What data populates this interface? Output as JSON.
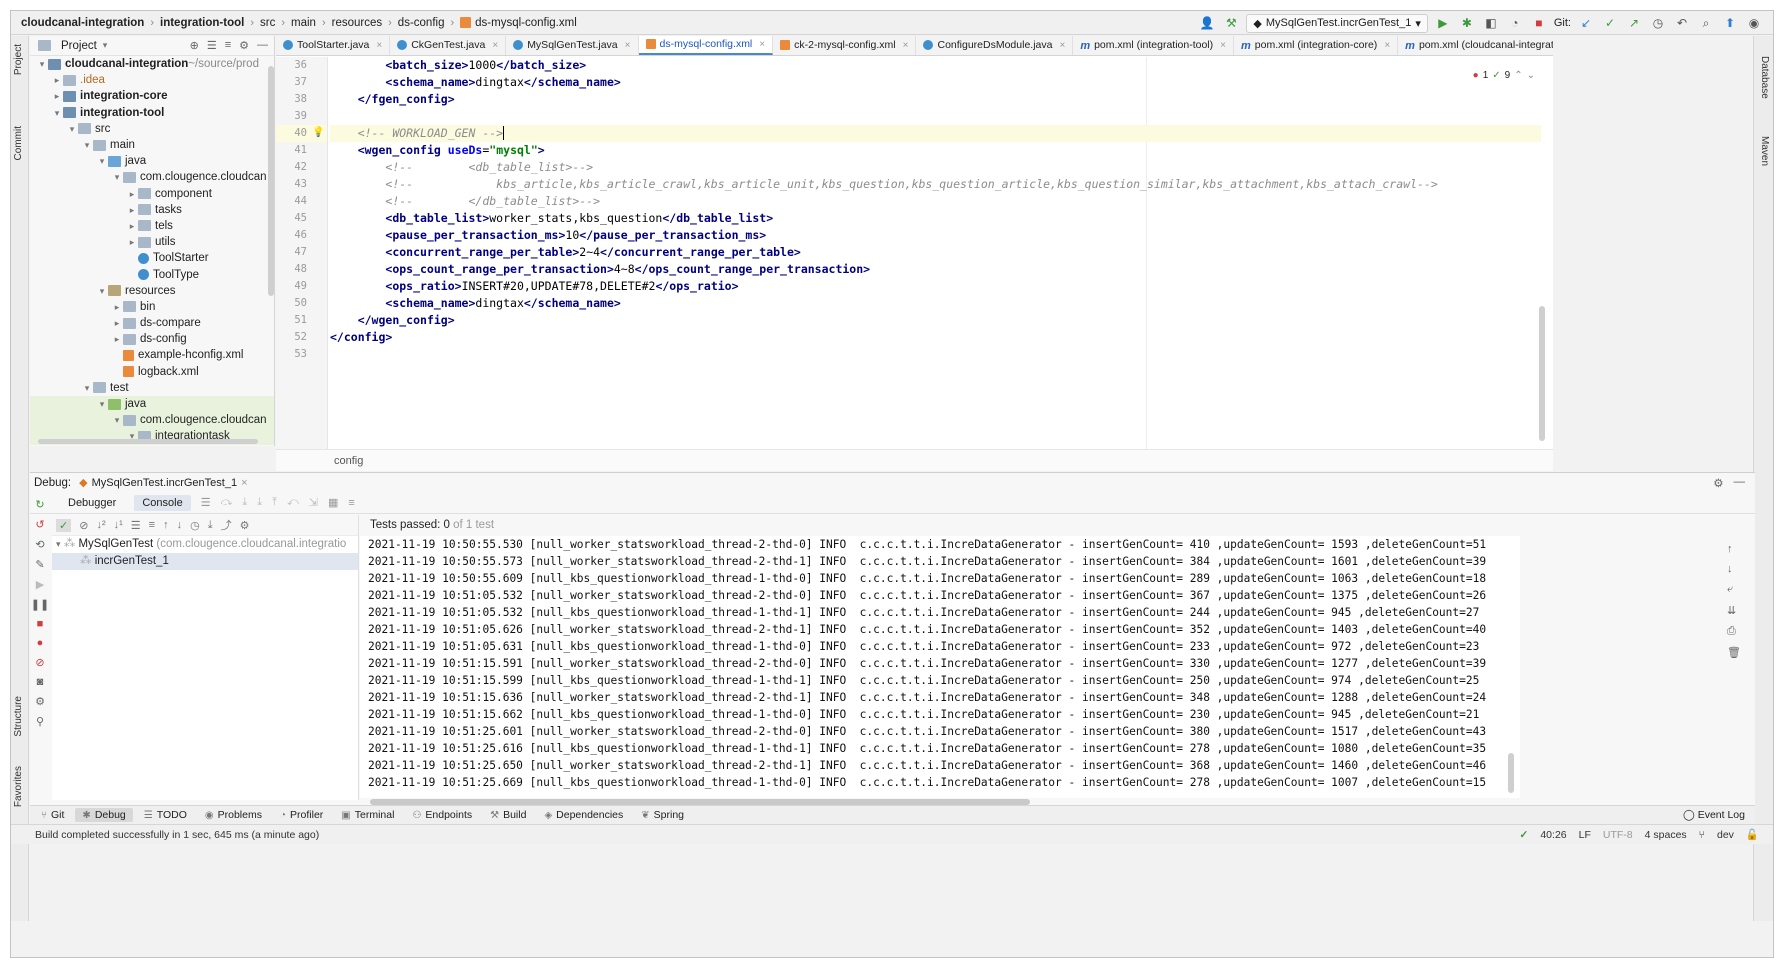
{
  "navbar": {
    "breadcrumbs": [
      "cloudcanal-integration",
      "integration-tool",
      "src",
      "main",
      "resources",
      "ds-config",
      "ds-mysql-config.xml"
    ],
    "run_config": "MySqlGenTest.incrGenTest_1",
    "git_label": "Git:"
  },
  "project": {
    "title": "Project",
    "rows": [
      {
        "indent": 0,
        "arrow": "▾",
        "icon": "module",
        "label": "cloudcanal-integration",
        "suffix": " ~/source/prod",
        "bold": true
      },
      {
        "indent": 1,
        "arrow": "▸",
        "icon": "folder",
        "label": ".idea",
        "orange": true
      },
      {
        "indent": 1,
        "arrow": "▸",
        "icon": "module",
        "label": "integration-core",
        "bold": true
      },
      {
        "indent": 1,
        "arrow": "▾",
        "icon": "module",
        "label": "integration-tool",
        "bold": true
      },
      {
        "indent": 2,
        "arrow": "▾",
        "icon": "folder",
        "label": "src"
      },
      {
        "indent": 3,
        "arrow": "▾",
        "icon": "folder",
        "label": "main"
      },
      {
        "indent": 4,
        "arrow": "▾",
        "icon": "folder-blue",
        "label": "java"
      },
      {
        "indent": 5,
        "arrow": "▾",
        "icon": "folder",
        "label": "com.clougence.cloudcan"
      },
      {
        "indent": 6,
        "arrow": "▸",
        "icon": "folder",
        "label": "component"
      },
      {
        "indent": 6,
        "arrow": "▸",
        "icon": "folder",
        "label": "tasks"
      },
      {
        "indent": 6,
        "arrow": "▸",
        "icon": "folder",
        "label": "tels"
      },
      {
        "indent": 6,
        "arrow": "▸",
        "icon": "folder",
        "label": "utils"
      },
      {
        "indent": 6,
        "arrow": "",
        "icon": "java",
        "label": "ToolStarter"
      },
      {
        "indent": 6,
        "arrow": "",
        "icon": "java",
        "label": "ToolType"
      },
      {
        "indent": 4,
        "arrow": "▾",
        "icon": "folder-res",
        "label": "resources"
      },
      {
        "indent": 5,
        "arrow": "▸",
        "icon": "folder",
        "label": "bin"
      },
      {
        "indent": 5,
        "arrow": "▸",
        "icon": "folder",
        "label": "ds-compare"
      },
      {
        "indent": 5,
        "arrow": "▸",
        "icon": "folder",
        "label": "ds-config"
      },
      {
        "indent": 5,
        "arrow": "",
        "icon": "xml",
        "label": "example-hconfig.xml"
      },
      {
        "indent": 5,
        "arrow": "",
        "icon": "xml",
        "label": "logback.xml"
      },
      {
        "indent": 3,
        "arrow": "▾",
        "icon": "folder",
        "label": "test"
      },
      {
        "indent": 4,
        "arrow": "▾",
        "icon": "folder-green",
        "label": "java",
        "sel": true
      },
      {
        "indent": 5,
        "arrow": "▾",
        "icon": "folder",
        "label": "com.clougence.cloudcan",
        "sel": true
      },
      {
        "indent": 6,
        "arrow": "▾",
        "icon": "folder",
        "label": "integrationtask",
        "sel": true
      }
    ]
  },
  "editor": {
    "tabs": [
      {
        "label": "ToolStarter.java",
        "kind": "j"
      },
      {
        "label": "CkGenTest.java",
        "kind": "j"
      },
      {
        "label": "MySqlGenTest.java",
        "kind": "j"
      },
      {
        "label": "ds-mysql-config.xml",
        "kind": "x2",
        "active": true
      },
      {
        "label": "ck-2-mysql-config.xml",
        "kind": "x2"
      },
      {
        "label": "ConfigureDsModule.java",
        "kind": "j"
      },
      {
        "label": "pom.xml (integration-tool)",
        "kind": "m"
      },
      {
        "label": "pom.xml (integration-core)",
        "kind": "m"
      },
      {
        "label": "pom.xml (cloudcanal-integration)",
        "kind": "m"
      }
    ],
    "line_numbers": [
      "36",
      "37",
      "38",
      "39",
      "40",
      "41",
      "42",
      "43",
      "44",
      "45",
      "46",
      "47",
      "48",
      "49",
      "50",
      "51",
      "52",
      "53"
    ],
    "inspection": {
      "errors": "1",
      "warnings": "9"
    },
    "breadcrumb": "config"
  },
  "debug": {
    "label": "Debug:",
    "session": "MySqlGenTest.incrGenTest_1",
    "sub_tabs": {
      "debugger": "Debugger",
      "console": "Console"
    },
    "tests_passed": "Tests passed: 0",
    "tests_of": "of 1 test",
    "tree": [
      {
        "label": "MySqlGenTest",
        "suffix": " (com.clougence.cloudcanal.integratio"
      },
      {
        "label": "incrGenTest_1"
      }
    ],
    "logs": [
      "2021-11-19 10:50:55.530 [null_worker_statsworkload_thread-2-thd-0] INFO  c.c.c.t.t.i.IncreDataGenerator - insertGenCount= 410 ,updateGenCount= 1593 ,deleteGenCount=51",
      "2021-11-19 10:50:55.573 [null_worker_statsworkload_thread-2-thd-1] INFO  c.c.c.t.t.i.IncreDataGenerator - insertGenCount= 384 ,updateGenCount= 1601 ,deleteGenCount=39",
      "2021-11-19 10:50:55.609 [null_kbs_questionworkload_thread-1-thd-0] INFO  c.c.c.t.t.i.IncreDataGenerator - insertGenCount= 289 ,updateGenCount= 1063 ,deleteGenCount=18",
      "2021-11-19 10:51:05.532 [null_worker_statsworkload_thread-2-thd-0] INFO  c.c.c.t.t.i.IncreDataGenerator - insertGenCount= 367 ,updateGenCount= 1375 ,deleteGenCount=26",
      "2021-11-19 10:51:05.532 [null_kbs_questionworkload_thread-1-thd-1] INFO  c.c.c.t.t.i.IncreDataGenerator - insertGenCount= 244 ,updateGenCount= 945 ,deleteGenCount=27",
      "2021-11-19 10:51:05.626 [null_worker_statsworkload_thread-2-thd-1] INFO  c.c.c.t.t.i.IncreDataGenerator - insertGenCount= 352 ,updateGenCount= 1403 ,deleteGenCount=40",
      "2021-11-19 10:51:05.631 [null_kbs_questionworkload_thread-1-thd-0] INFO  c.c.c.t.t.i.IncreDataGenerator - insertGenCount= 233 ,updateGenCount= 972 ,deleteGenCount=23",
      "2021-11-19 10:51:15.591 [null_worker_statsworkload_thread-2-thd-0] INFO  c.c.c.t.t.i.IncreDataGenerator - insertGenCount= 330 ,updateGenCount= 1277 ,deleteGenCount=39",
      "2021-11-19 10:51:15.599 [null_kbs_questionworkload_thread-1-thd-1] INFO  c.c.c.t.t.i.IncreDataGenerator - insertGenCount= 250 ,updateGenCount= 974 ,deleteGenCount=25",
      "2021-11-19 10:51:15.636 [null_worker_statsworkload_thread-2-thd-1] INFO  c.c.c.t.t.i.IncreDataGenerator - insertGenCount= 348 ,updateGenCount= 1288 ,deleteGenCount=24",
      "2021-11-19 10:51:15.662 [null_kbs_questionworkload_thread-1-thd-0] INFO  c.c.c.t.t.i.IncreDataGenerator - insertGenCount= 230 ,updateGenCount= 945 ,deleteGenCount=21",
      "2021-11-19 10:51:25.601 [null_worker_statsworkload_thread-2-thd-0] INFO  c.c.c.t.t.i.IncreDataGenerator - insertGenCount= 380 ,updateGenCount= 1517 ,deleteGenCount=43",
      "2021-11-19 10:51:25.616 [null_kbs_questionworkload_thread-1-thd-1] INFO  c.c.c.t.t.i.IncreDataGenerator - insertGenCount= 278 ,updateGenCount= 1080 ,deleteGenCount=35",
      "2021-11-19 10:51:25.650 [null_worker_statsworkload_thread-2-thd-1] INFO  c.c.c.t.t.i.IncreDataGenerator - insertGenCount= 368 ,updateGenCount= 1460 ,deleteGenCount=46",
      "2021-11-19 10:51:25.669 [null_kbs_questionworkload_thread-1-thd-0] INFO  c.c.c.t.t.i.IncreDataGenerator - insertGenCount= 278 ,updateGenCount= 1007 ,deleteGenCount=15"
    ]
  },
  "tool_tabs": [
    "Git",
    "Debug",
    "TODO",
    "Problems",
    "Profiler",
    "Terminal",
    "Endpoints",
    "Build",
    "Dependencies",
    "Spring"
  ],
  "tool_tab_active": "Debug",
  "event_log": "Event Log",
  "side_tabs": {
    "project": "Project",
    "commit": "Commit",
    "structure": "Structure",
    "favorites": "Favorites",
    "database": "Database",
    "maven": "Maven"
  },
  "status": {
    "message": "Build completed successfully in 1 sec, 645 ms (a minute ago)",
    "position": "40:26",
    "line_sep": "LF",
    "encoding": "UTF-8",
    "indent": "4 spaces",
    "branch": "dev"
  }
}
